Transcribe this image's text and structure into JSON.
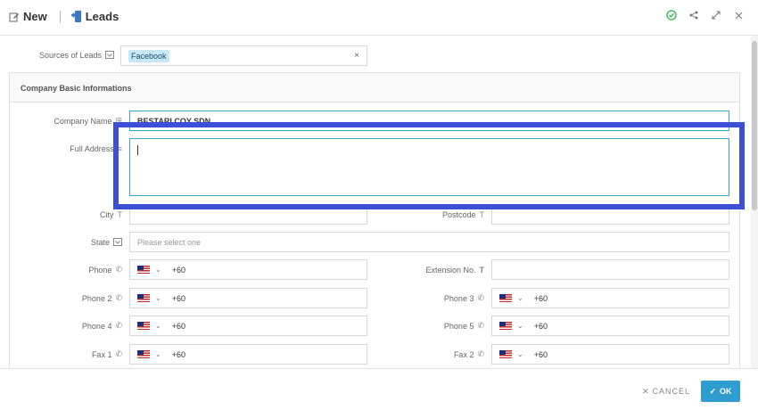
{
  "header": {
    "new_label": "New",
    "module_label": "Leads"
  },
  "sources": {
    "label": "Sources of Leads",
    "selected_tag": "Facebook",
    "clear_symbol": "×"
  },
  "section": {
    "title": "Company Basic Informations"
  },
  "company": {
    "name_label": "Company Name",
    "name_value": "BESTARI COY SDN"
  },
  "address": {
    "label": "Full Address"
  },
  "city": {
    "label": "City"
  },
  "postcode": {
    "label": "Postcode"
  },
  "state": {
    "label": "State",
    "placeholder": "Please select one"
  },
  "phones": {
    "country_code": "+60",
    "phone_label": "Phone",
    "extension_label": "Extension No.",
    "phone2_label": "Phone 2",
    "phone3_label": "Phone 3",
    "phone4_label": "Phone 4",
    "phone5_label": "Phone 5",
    "fax1_label": "Fax 1",
    "fax2_label": "Fax 2"
  },
  "footer": {
    "cancel_label": "CANCEL",
    "ok_label": "OK"
  },
  "colors": {
    "accent": "#2f9dd0",
    "highlight": "#3d4fd6",
    "tag_bg": "#c9e8f5",
    "status_green": "#2bb24c"
  },
  "icons": [
    "edit-icon",
    "leads-icon",
    "check-circle-icon",
    "share-icon",
    "expand-icon",
    "close-icon",
    "dropdown-icon",
    "phone-icon",
    "text-icon",
    "times-icon",
    "check-icon"
  ]
}
